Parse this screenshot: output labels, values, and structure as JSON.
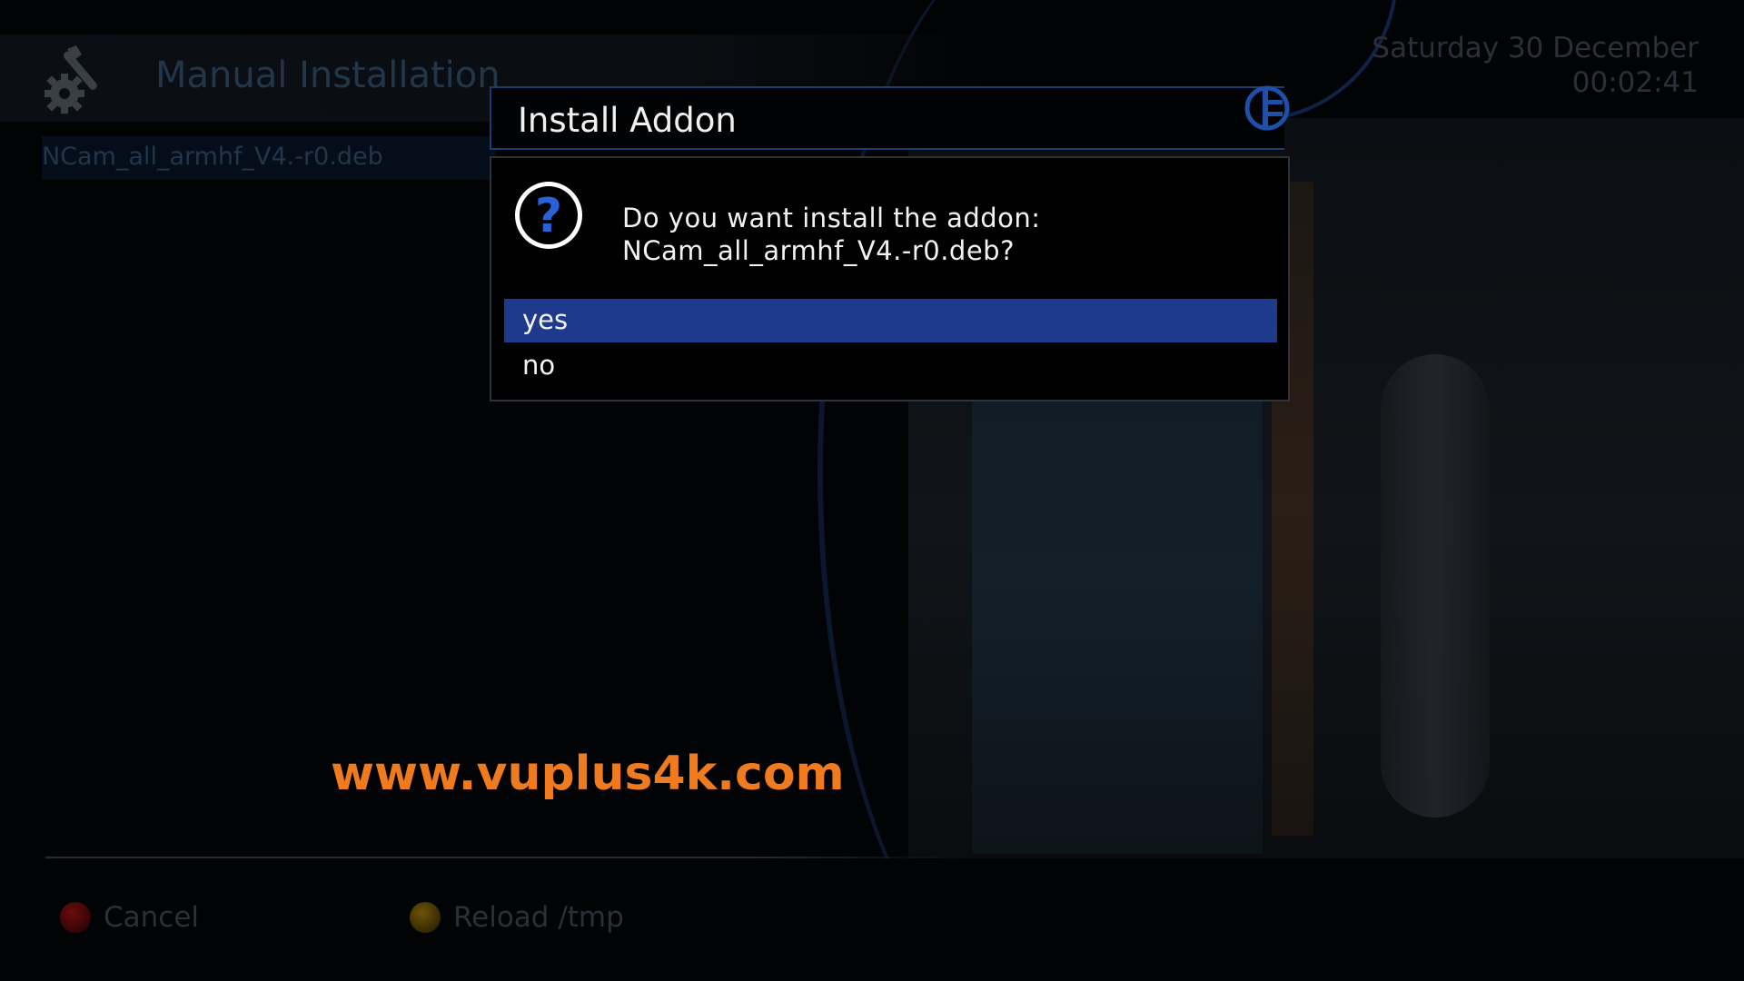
{
  "screen": {
    "title": "Manual Installation",
    "file_list": [
      "NCam_all_armhf_V4.-r0.deb"
    ],
    "date": "Saturday 30 December",
    "time": "00:02:41"
  },
  "dialog": {
    "title": "Install Addon",
    "message_line1": "Do you want install the addon:",
    "message_line2": "NCam_all_armhf_V4.-r0.deb?",
    "options": [
      {
        "label": "yes",
        "selected": true
      },
      {
        "label": "no",
        "selected": false
      }
    ]
  },
  "footer": {
    "buttons": [
      {
        "label": "Cancel",
        "color": "red"
      },
      {
        "label": "Reload /tmp",
        "color": "yellow"
      }
    ]
  },
  "watermark": "www.vuplus4k.com",
  "icons": {
    "header": "settings-tools-icon",
    "dialog": "question-icon",
    "brand": "brand-logo-icon"
  },
  "colors": {
    "selection": "#1e3a8c",
    "dialog_border": "#1a3d73",
    "watermark": "#f07a1e",
    "footer_red": "#6a0d0d",
    "footer_yellow": "#6e5307"
  }
}
